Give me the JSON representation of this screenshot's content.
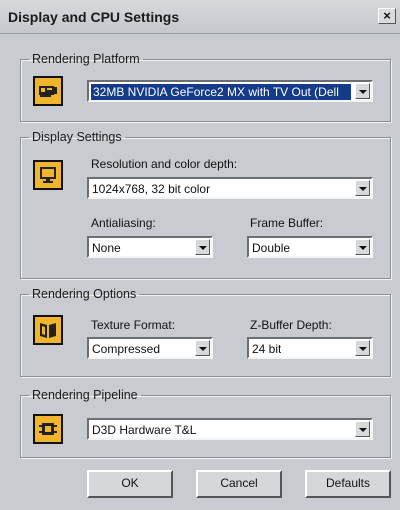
{
  "window": {
    "title": "Display and CPU Settings",
    "close_label": "×"
  },
  "rendering_platform": {
    "legend": "Rendering Platform",
    "icon": "graphics-card-icon",
    "device": {
      "value": "32MB NVIDIA GeForce2 MX with TV Out (Dell"
    }
  },
  "display_settings": {
    "legend": "Display Settings",
    "icon": "monitor-icon",
    "resolution": {
      "label": "Resolution and color depth:",
      "value": "1024x768, 32 bit color"
    },
    "antialiasing": {
      "label": "Antialiasing:",
      "value": "None"
    },
    "frame_buffer": {
      "label": "Frame Buffer:",
      "value": "Double"
    }
  },
  "rendering_options": {
    "legend": "Rendering Options",
    "icon": "book-icon",
    "texture_format": {
      "label": "Texture Format:",
      "value": "Compressed"
    },
    "zbuffer_depth": {
      "label": "Z-Buffer Depth:",
      "value": "24 bit"
    }
  },
  "rendering_pipeline": {
    "legend": "Rendering Pipeline",
    "icon": "chip-icon",
    "pipeline": {
      "value": "D3D Hardware T&L"
    }
  },
  "buttons": {
    "ok": "OK",
    "cancel": "Cancel",
    "defaults": "Defaults"
  },
  "colors": {
    "icon_bg": "#f1b52d",
    "selection": "#143a8a",
    "dialog_bg": "#c8ccd1"
  }
}
